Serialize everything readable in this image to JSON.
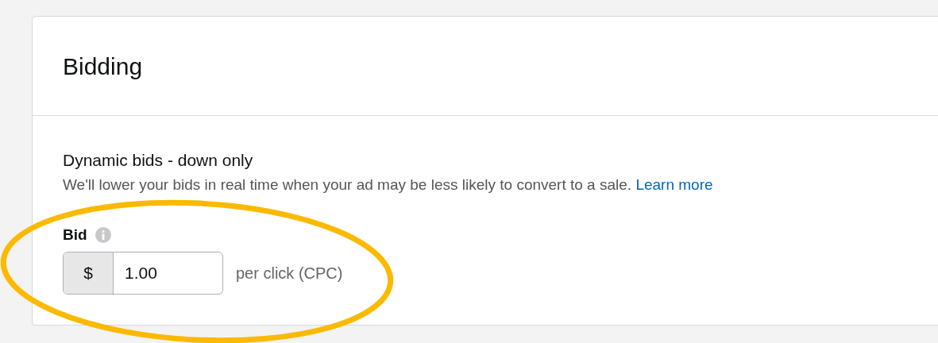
{
  "card": {
    "title": "Bidding"
  },
  "strategy": {
    "title": "Dynamic bids - down only",
    "description": "We'll lower your bids in real time when your ad may be less likely to convert to a sale.",
    "link": "Learn more"
  },
  "bid": {
    "label": "Bid",
    "currency": "$",
    "value": "1.00",
    "suffix": "per click (CPC)"
  },
  "annotation": {
    "kind": "ellipse",
    "color": "#fbb900"
  }
}
